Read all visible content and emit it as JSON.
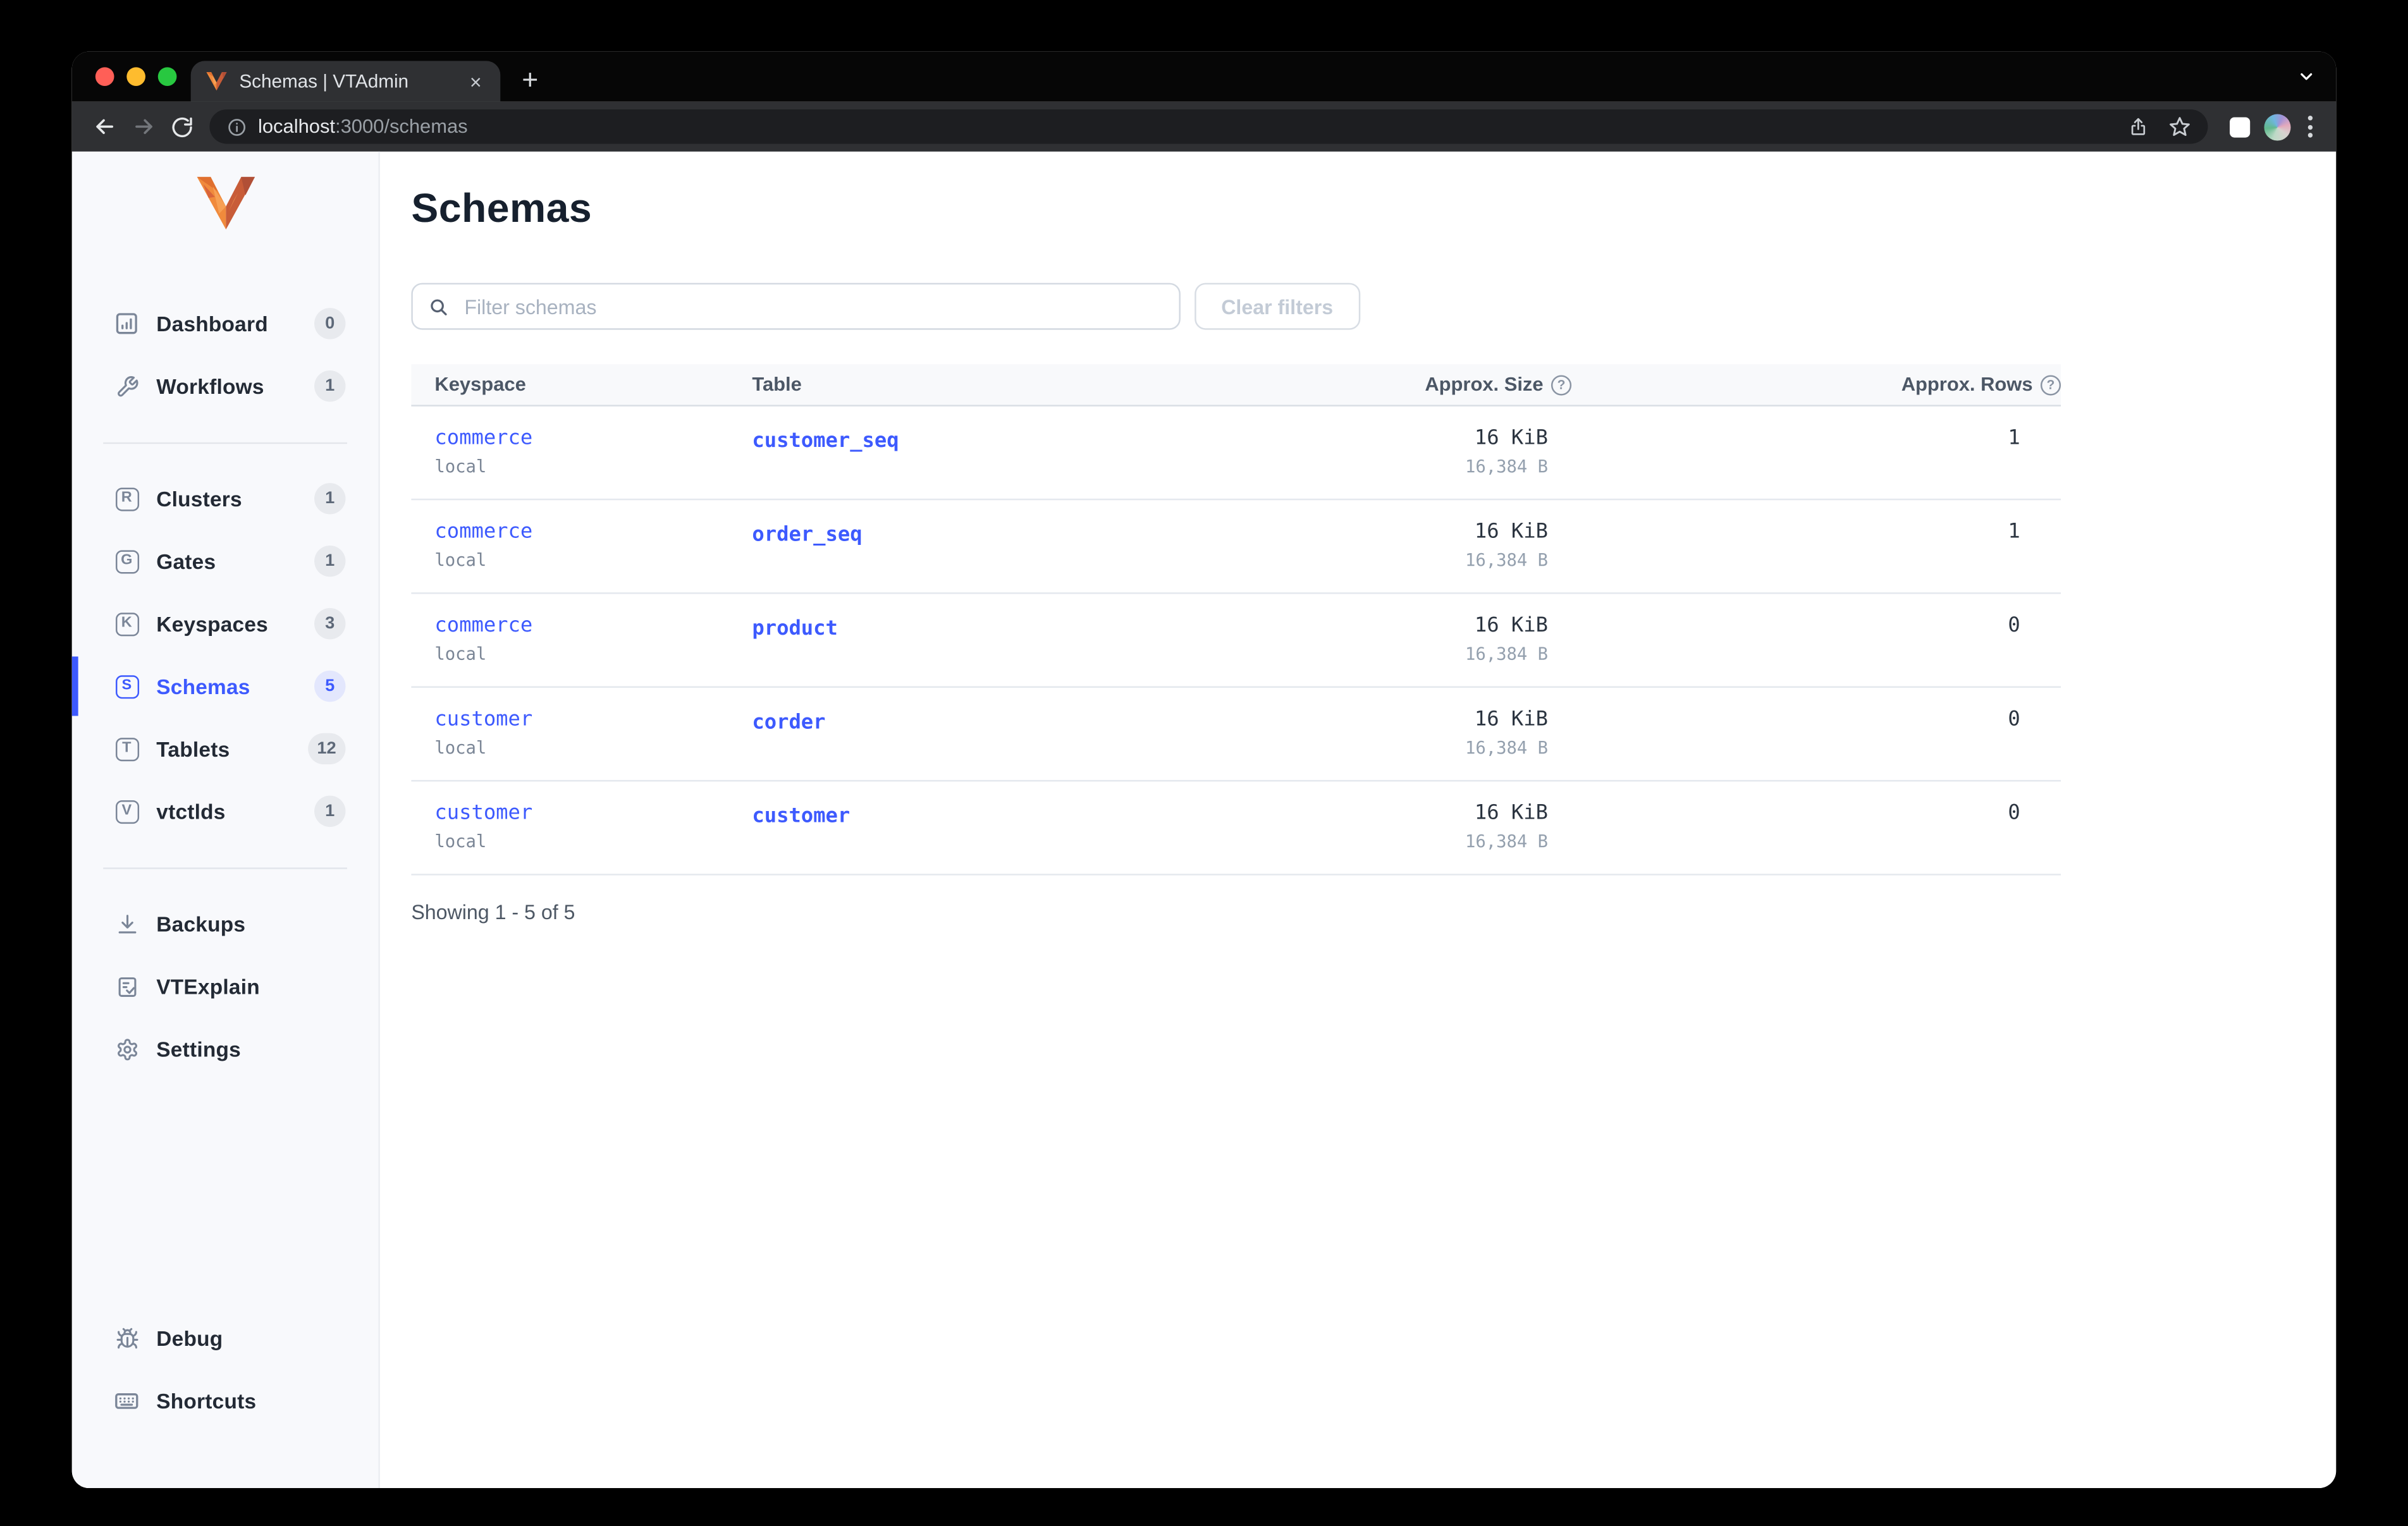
{
  "colors": {
    "accent_blue": "#3d5afe",
    "vitess_orange": "#ee8132",
    "sidebar_bg": "#f8f9fc",
    "chrome_dark": "#2f3033",
    "link_blue": "#3d5afe"
  },
  "browser": {
    "tab_title": "Schemas | VTAdmin",
    "close_tab_glyph": "×",
    "new_tab_glyph": "+",
    "url_host": "localhost",
    "url_rest": ":3000/schemas"
  },
  "sidebar": {
    "items": [
      {
        "label": "Dashboard",
        "count": "0",
        "icon": "dashboard-chart-icon"
      },
      {
        "label": "Workflows",
        "count": "1",
        "icon": "wrench-icon"
      },
      {
        "label": "Clusters",
        "count": "1",
        "letter": "R"
      },
      {
        "label": "Gates",
        "count": "1",
        "letter": "G"
      },
      {
        "label": "Keyspaces",
        "count": "3",
        "letter": "K"
      },
      {
        "label": "Schemas",
        "count": "5",
        "letter": "S",
        "active": true
      },
      {
        "label": "Tablets",
        "count": "12",
        "letter": "T"
      },
      {
        "label": "vtctlds",
        "count": "1",
        "letter": "V"
      },
      {
        "label": "Backups",
        "icon": "download-icon"
      },
      {
        "label": "VTExplain",
        "icon": "document-check-icon"
      },
      {
        "label": "Settings",
        "icon": "gear-icon"
      },
      {
        "label": "Debug",
        "icon": "bug-icon"
      },
      {
        "label": "Shortcuts",
        "icon": "keyboard-icon"
      }
    ]
  },
  "main": {
    "title": "Schemas",
    "filter_placeholder": "Filter schemas",
    "clear_filters_label": "Clear filters",
    "help_glyph": "?",
    "table": {
      "headers": [
        "Keyspace",
        "Table",
        "Approx. Size",
        "Approx. Rows"
      ],
      "rows": [
        {
          "keyspace": "commerce",
          "cluster": "local",
          "table": "customer_seq",
          "size": "16 KiB",
          "size_bytes": "16,384 B",
          "rows": "1"
        },
        {
          "keyspace": "commerce",
          "cluster": "local",
          "table": "order_seq",
          "size": "16 KiB",
          "size_bytes": "16,384 B",
          "rows": "1"
        },
        {
          "keyspace": "commerce",
          "cluster": "local",
          "table": "product",
          "size": "16 KiB",
          "size_bytes": "16,384 B",
          "rows": "0"
        },
        {
          "keyspace": "customer",
          "cluster": "local",
          "table": "corder",
          "size": "16 KiB",
          "size_bytes": "16,384 B",
          "rows": "0"
        },
        {
          "keyspace": "customer",
          "cluster": "local",
          "table": "customer",
          "size": "16 KiB",
          "size_bytes": "16,384 B",
          "rows": "0"
        }
      ]
    },
    "footer": "Showing 1 - 5 of 5"
  }
}
